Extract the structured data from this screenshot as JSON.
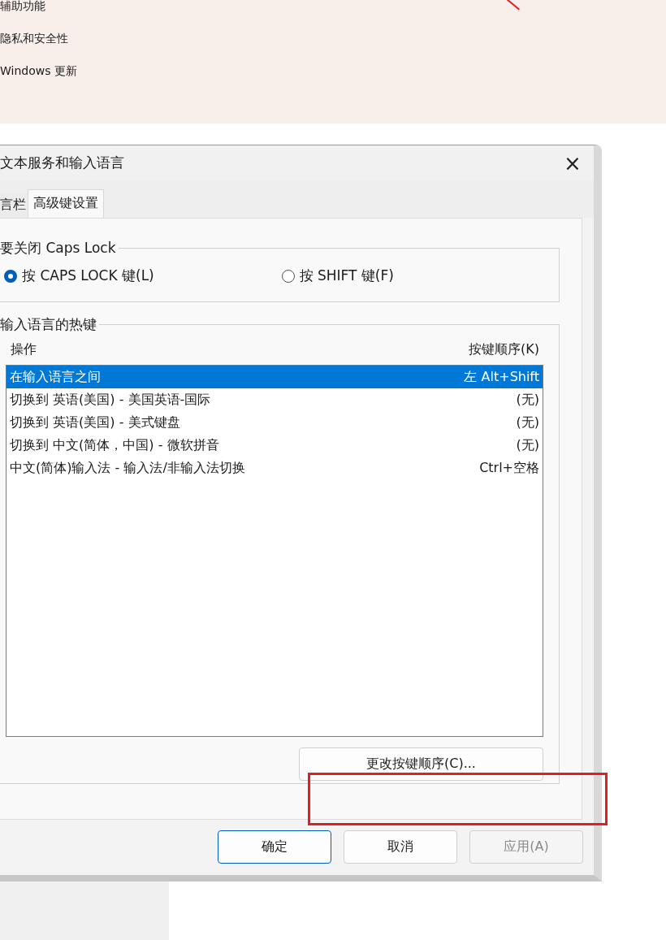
{
  "settings_nav": {
    "items": [
      {
        "label": "辅助功能"
      },
      {
        "label": "隐私和安全性"
      },
      {
        "label": "Windows 更新"
      }
    ]
  },
  "dialog": {
    "title": "文本服务和输入语言",
    "close": "×",
    "tabs": [
      {
        "label": "言栏",
        "selected": false
      },
      {
        "label": "高级键设置",
        "selected": true
      }
    ],
    "caps_lock": {
      "title": "要关闭 Caps Lock",
      "options": [
        {
          "label": "按 CAPS LOCK 键(L)",
          "selected": true
        },
        {
          "label": "按 SHIFT 键(F)",
          "selected": false
        }
      ]
    },
    "hotkeys": {
      "title": "输入语言的热键",
      "columns": [
        "操作",
        "按键顺序(K)"
      ],
      "rows": [
        {
          "action": "在输入语言之间",
          "keys": "左 Alt+Shift",
          "selected": true
        },
        {
          "action": "切换到 英语(美国) - 美国英语-国际",
          "keys": "(无)",
          "selected": false
        },
        {
          "action": "切换到 英语(美国) - 美式键盘",
          "keys": "(无)",
          "selected": false
        },
        {
          "action": "切换到 中文(简体，中国) - 微软拼音",
          "keys": "(无)",
          "selected": false
        },
        {
          "action": "中文(简体)输入法 - 输入法/非输入法切换",
          "keys": "Ctrl+空格",
          "selected": false
        }
      ],
      "change_button": "更改按键顺序(C)..."
    },
    "buttons": [
      {
        "label": "确定",
        "kind": "default",
        "disabled": false
      },
      {
        "label": "取消",
        "kind": "normal",
        "disabled": false
      },
      {
        "label": "应用(A)",
        "kind": "normal",
        "disabled": true
      }
    ]
  }
}
